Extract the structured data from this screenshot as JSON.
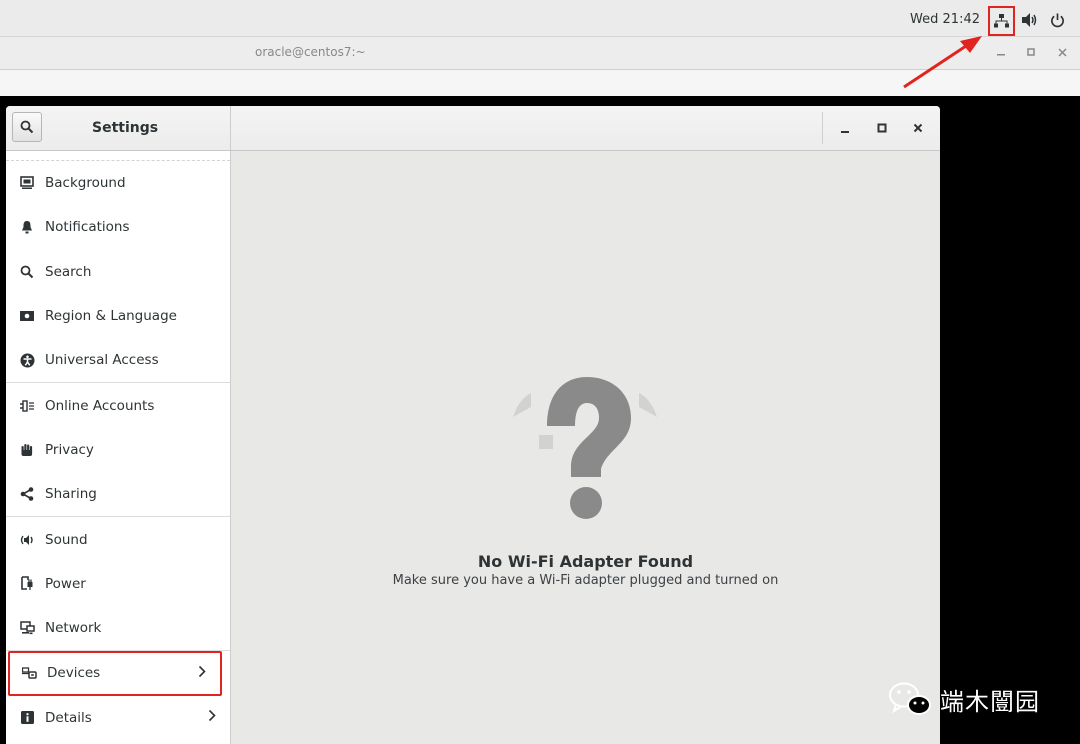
{
  "topbar": {
    "clock": "Wed 21:42"
  },
  "terminal": {
    "title": "oracle@centos7:~"
  },
  "window": {
    "title": "Settings",
    "controls": {
      "minimize": "–",
      "maximize": "□",
      "close": "×"
    }
  },
  "sidebar": {
    "items": [
      {
        "label": "Background",
        "icon": "background-icon"
      },
      {
        "label": "Notifications",
        "icon": "bell-icon"
      },
      {
        "label": "Search",
        "icon": "search-icon"
      },
      {
        "label": "Region & Language",
        "icon": "flag-icon"
      },
      {
        "label": "Universal Access",
        "icon": "accessibility-icon"
      },
      {
        "label": "Online Accounts",
        "icon": "online-accounts-icon"
      },
      {
        "label": "Privacy",
        "icon": "hand-icon"
      },
      {
        "label": "Sharing",
        "icon": "share-icon"
      },
      {
        "label": "Sound",
        "icon": "speaker-icon"
      },
      {
        "label": "Power",
        "icon": "power-plug-icon"
      },
      {
        "label": "Network",
        "icon": "network-icon"
      },
      {
        "label": "Devices",
        "icon": "devices-icon",
        "chevron": "›"
      },
      {
        "label": "Details",
        "icon": "info-icon",
        "chevron": "›"
      }
    ]
  },
  "content": {
    "empty_title": "No Wi-Fi Adapter Found",
    "empty_subtitle": "Make sure you have a Wi-Fi adapter plugged and turned on"
  },
  "watermark": {
    "text": "端木闓园"
  },
  "colors": {
    "annotation_red": "#e1241f",
    "question_gray": "#8a8a8a"
  }
}
